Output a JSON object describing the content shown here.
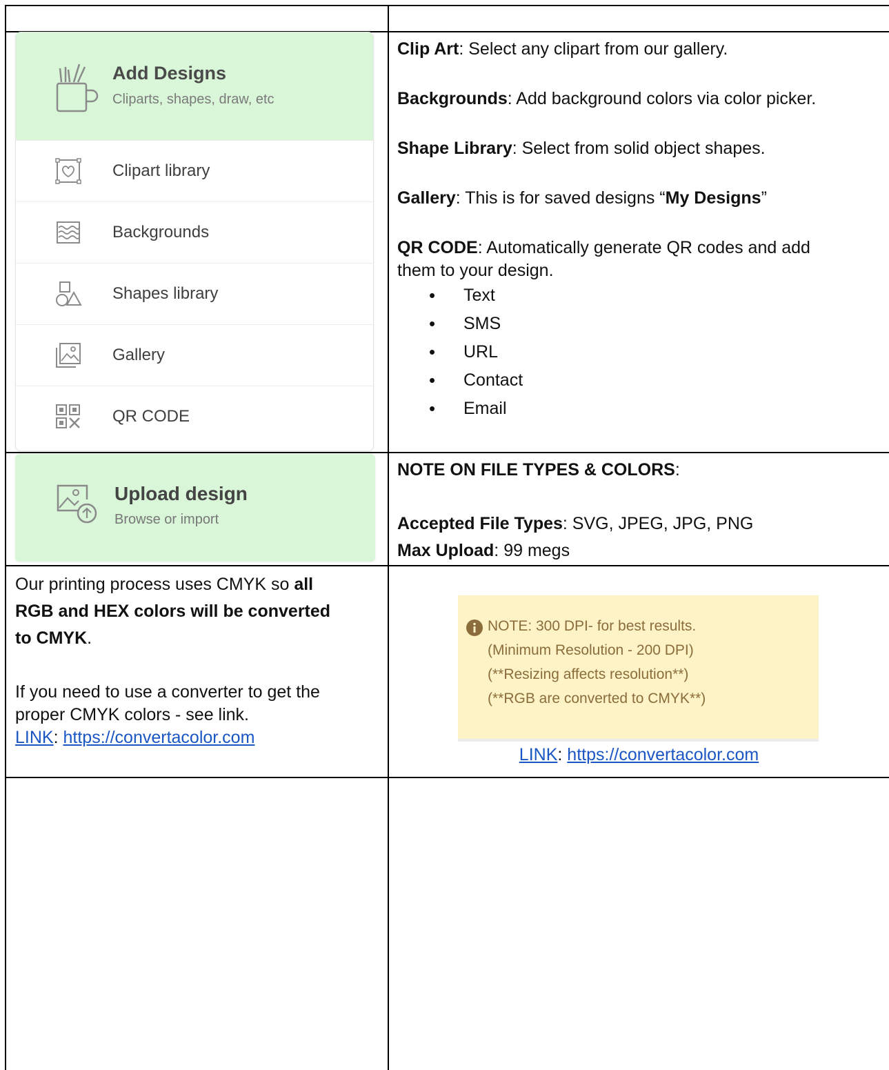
{
  "add_designs": {
    "title": "Add Designs",
    "subtitle": "Cliparts, shapes, draw, etc",
    "items": [
      {
        "label": "Clipart library",
        "icon": "clipart-icon"
      },
      {
        "label": "Backgrounds",
        "icon": "backgrounds-icon"
      },
      {
        "label": "Shapes library",
        "icon": "shapes-icon"
      },
      {
        "label": "Gallery",
        "icon": "gallery-icon"
      },
      {
        "label": "QR CODE",
        "icon": "qr-code-icon"
      }
    ]
  },
  "descriptions": {
    "clip_art": {
      "term": "Clip Art",
      "text": ": Select any clipart from our gallery."
    },
    "backgrounds": {
      "term": "Backgrounds",
      "text": ": Add background colors via color picker."
    },
    "shape_library": {
      "term": "Shape Library",
      "text": ": Select from solid object shapes."
    },
    "gallery": {
      "term": "Gallery",
      "text": ": This is for saved designs “",
      "strong": "My Designs",
      "end": "”"
    },
    "qr_code": {
      "term": "QR CODE",
      "text": ": Automatically generate QR codes and add",
      "text2": "them to your design."
    },
    "qr_types": [
      "Text",
      "SMS",
      "URL",
      "Contact",
      "Email"
    ]
  },
  "upload": {
    "title": "Upload design",
    "subtitle": "Browse or import"
  },
  "file_notes": {
    "heading": "NOTE ON FILE TYPES & COLORS",
    "heading_colon": ":",
    "accepted_label": "Accepted File Types",
    "accepted_value": ": SVG, JPEG, JPG, PNG",
    "max_label": "Max Upload",
    "max_value": ": 99 megs"
  },
  "cmyk": {
    "line1_pre": "Our printing process uses CMYK so ",
    "line1_bold": "all",
    "line2_bold": "RGB and HEX colors will be converted",
    "line3_bold": "to CMYK",
    "line3_post": ".",
    "para2_line1": "If you need to use a converter to get the",
    "para2_line2": "proper CMYK colors -  see link.",
    "link_label": "LINK",
    "link_sep": ": ",
    "link_url": "https://convertacolor.com"
  },
  "note_box": {
    "lines": [
      "NOTE: 300 DPI- for best results.",
      "(Minimum Resolution - 200 DPI)",
      "(**Resizing affects resolution**)",
      "(**RGB are converted to CMYK**)"
    ],
    "link_label": "LINK",
    "link_sep": ": ",
    "link_url": "https://convertacolor.com"
  },
  "colors": {
    "panel_green": "#d9f6d9",
    "note_yellow": "#fdf3c6",
    "note_text": "#8a6d3b",
    "link_blue": "#1a56c4"
  }
}
